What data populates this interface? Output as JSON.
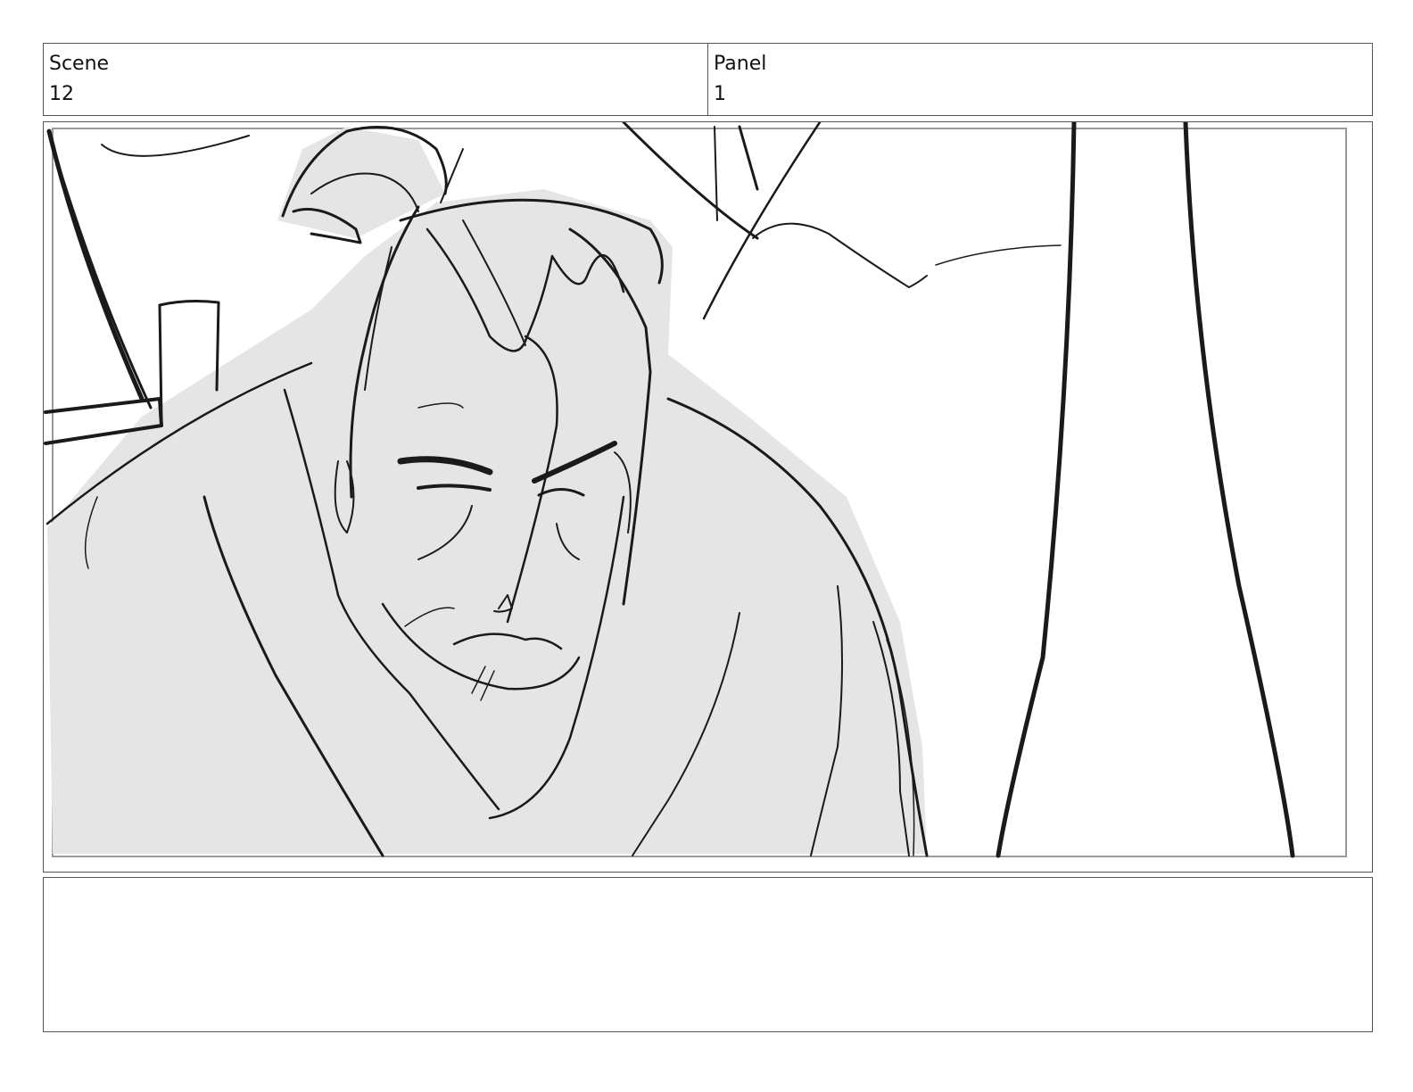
{
  "header": {
    "scene_label": "Scene",
    "scene_value": "12",
    "panel_label": "Panel",
    "panel_value": "1"
  },
  "drawing": {
    "subject": "storyboard sketch",
    "fill_color": "#e5e5e5",
    "line_color": "#1a1a1a"
  },
  "notes": {
    "text": ""
  }
}
